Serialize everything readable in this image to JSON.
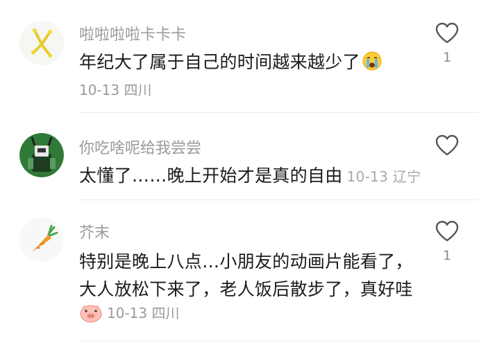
{
  "comments": [
    {
      "username": "啦啦啦啦卡卡卡",
      "text": "年纪大了属于自己的时间越来越少了",
      "emoji": "crying-emoji",
      "date": "10-13",
      "location": "四川",
      "likes": "1"
    },
    {
      "username": "你吃啥呢给我尝尝",
      "text": "太懂了……晚上开始才是真的自由",
      "date": "10-13",
      "location": "辽宁",
      "likes": ""
    },
    {
      "username": "芥末",
      "text_line1": "特别是晚上八点…小朋友的动画片能看了，",
      "text_line2": "大人放松下来了，老人饭后散步了，真好哇",
      "sticker": "pig-face-sticker",
      "date": "10-13",
      "location": "四川",
      "likes": "1"
    }
  ],
  "colors": {
    "text": "#1b1b1b",
    "muted": "#9a9a9a",
    "divider": "#ececec"
  }
}
